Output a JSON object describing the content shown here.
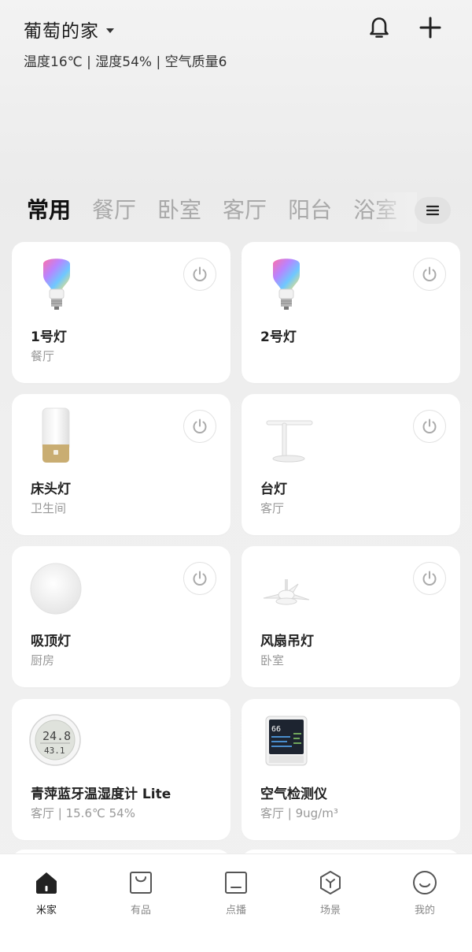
{
  "header": {
    "home_name": "葡萄的家",
    "env_status": "温度16℃ | 湿度54% | 空气质量6",
    "bell_icon": "bell-icon",
    "add_icon": "plus-icon"
  },
  "tabs": {
    "items": [
      "常用",
      "餐厅",
      "卧室",
      "客厅",
      "阳台",
      "浴室"
    ],
    "active": "常用",
    "menu_icon": "hamburger-icon"
  },
  "devices": [
    {
      "name": "1号灯",
      "room": "餐厅",
      "icon": "color-bulb-icon",
      "has_power": true
    },
    {
      "name": "2号灯",
      "room": "",
      "icon": "color-bulb-icon",
      "has_power": true
    },
    {
      "name": "床头灯",
      "room": "卫生间",
      "icon": "bedside-lamp-icon",
      "has_power": true
    },
    {
      "name": "台灯",
      "room": "客厅",
      "icon": "desk-lamp-icon",
      "has_power": true
    },
    {
      "name": "吸顶灯",
      "room": "厨房",
      "icon": "ceiling-light-icon",
      "has_power": true
    },
    {
      "name": "风扇吊灯",
      "room": "卧室",
      "icon": "fan-light-icon",
      "has_power": true
    },
    {
      "name": "青萍蓝牙温湿度计 Lite",
      "room": "客厅 | 15.6℃ 54%",
      "icon": "thermo-hygrometer-icon",
      "has_power": false,
      "display_top": "24.8",
      "display_bottom": "43.1"
    },
    {
      "name": "空气检测仪",
      "room": "客厅 | 9ug/m³",
      "icon": "air-monitor-icon",
      "has_power": false,
      "display_value": "66"
    }
  ],
  "nav": [
    {
      "label": "米家",
      "icon": "home-icon",
      "active": true
    },
    {
      "label": "有品",
      "icon": "shopping-bag-icon",
      "active": false
    },
    {
      "label": "点播",
      "icon": "tv-icon",
      "active": false
    },
    {
      "label": "场景",
      "icon": "scene-hex-icon",
      "active": false
    },
    {
      "label": "我的",
      "icon": "smiley-icon",
      "active": false
    }
  ],
  "colors": {
    "accent_text": "#222222",
    "muted_text": "#999999",
    "card_bg": "#ffffff",
    "page_bg": "#f2f2f2"
  }
}
